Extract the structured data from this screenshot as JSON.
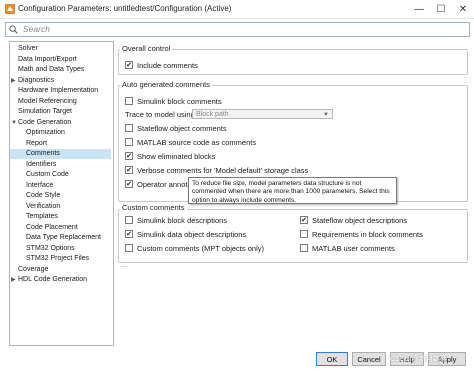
{
  "window": {
    "title": "Configuration Parameters: untitledtest/Configuration (Active)",
    "controls": {
      "minimize": "—",
      "maximize": "☐",
      "close": "✕"
    }
  },
  "search": {
    "placeholder": "Search"
  },
  "tree": [
    {
      "label": "Solver",
      "indent": 1,
      "arrow": "",
      "selected": false
    },
    {
      "label": "Data Import/Export",
      "indent": 1,
      "arrow": "",
      "selected": false
    },
    {
      "label": "Math and Data Types",
      "indent": 1,
      "arrow": "",
      "selected": false
    },
    {
      "label": "Diagnostics",
      "indent": 1,
      "arrow": "▶",
      "selected": false
    },
    {
      "label": "Hardware Implementation",
      "indent": 1,
      "arrow": "",
      "selected": false
    },
    {
      "label": "Model Referencing",
      "indent": 1,
      "arrow": "",
      "selected": false
    },
    {
      "label": "Simulation Target",
      "indent": 1,
      "arrow": "",
      "selected": false
    },
    {
      "label": "Code Generation",
      "indent": 1,
      "arrow": "▼",
      "selected": false
    },
    {
      "label": "Optimization",
      "indent": 2,
      "arrow": "",
      "selected": false
    },
    {
      "label": "Report",
      "indent": 2,
      "arrow": "",
      "selected": false
    },
    {
      "label": "Comments",
      "indent": 2,
      "arrow": "",
      "selected": true
    },
    {
      "label": "Identifiers",
      "indent": 2,
      "arrow": "",
      "selected": false
    },
    {
      "label": "Custom Code",
      "indent": 2,
      "arrow": "",
      "selected": false
    },
    {
      "label": "Interface",
      "indent": 2,
      "arrow": "",
      "selected": false
    },
    {
      "label": "Code Style",
      "indent": 2,
      "arrow": "",
      "selected": false
    },
    {
      "label": "Verification",
      "indent": 2,
      "arrow": "",
      "selected": false
    },
    {
      "label": "Templates",
      "indent": 2,
      "arrow": "",
      "selected": false
    },
    {
      "label": "Code Placement",
      "indent": 2,
      "arrow": "",
      "selected": false
    },
    {
      "label": "Data Type Replacement",
      "indent": 2,
      "arrow": "",
      "selected": false
    },
    {
      "label": "STM32 Options",
      "indent": 2,
      "arrow": "",
      "selected": false
    },
    {
      "label": "STM32 Project Files",
      "indent": 2,
      "arrow": "",
      "selected": false
    },
    {
      "label": "Coverage",
      "indent": 1,
      "arrow": "",
      "selected": false
    },
    {
      "label": "HDL Code Generation",
      "indent": 1,
      "arrow": "▶",
      "selected": false
    }
  ],
  "overall": {
    "heading": "Overall control",
    "include_comments": {
      "label": "Include comments",
      "checked": true
    }
  },
  "auto": {
    "heading": "Auto generated comments",
    "simulink_block_comments": {
      "label": "Simulink block comments",
      "checked": false
    },
    "trace_label": "Trace to model using:",
    "trace_value": "Block path",
    "stateflow_object_comments": {
      "label": "Stateflow object comments",
      "checked": false
    },
    "matlab_source_code": {
      "label": "MATLAB source code as comments",
      "checked": false
    },
    "show_eliminated_blocks": {
      "label": "Show eliminated blocks",
      "checked": true
    },
    "verbose_comments": {
      "label": "Verbose comments for 'Model default' storage class",
      "checked": true
    },
    "operator_annotations": {
      "label": "Operator annotat",
      "checked": true
    }
  },
  "tooltip": {
    "text": "To reduce file size, model parameters data structure is not commented when there are more than 1000 parameters.  Select this option to always include comments."
  },
  "custom": {
    "heading": "Custom comments",
    "simulink_block_descriptions": {
      "label": "Simulink block descriptions",
      "checked": false
    },
    "stateflow_object_descriptions": {
      "label": "Stateflow object descriptions",
      "checked": true
    },
    "simulink_data_object_descriptions": {
      "label": "Simulink data object descriptions",
      "checked": true
    },
    "requirements_in_block_comments": {
      "label": "Requirements in block comments",
      "checked": false
    },
    "custom_comments_mpt": {
      "label": "Custom comments (MPT objects only)",
      "checked": false
    },
    "matlab_user_comments": {
      "label": "MATLAB user comments",
      "checked": false
    }
  },
  "more_indicator": "...",
  "buttons": {
    "ok": "OK",
    "cancel": "Cancel",
    "help": "Help",
    "apply": "Apply"
  },
  "watermark": "CSDN @新月霜落",
  "colors": {
    "selection": "#c9e3f7",
    "default_button_border": "#2f7ed8"
  }
}
